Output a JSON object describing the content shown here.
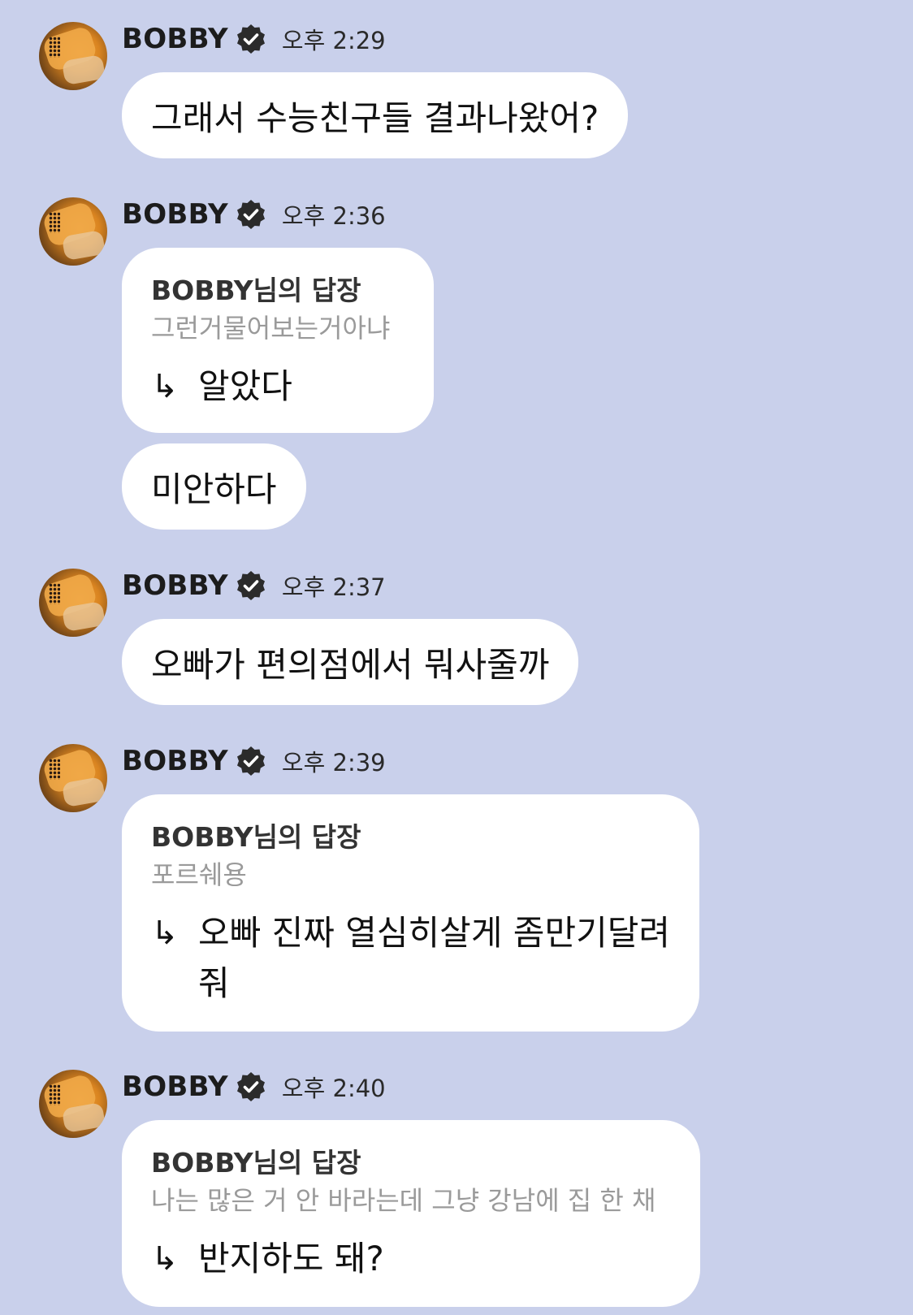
{
  "sender": {
    "name": "BOBBY",
    "avatar": "avatar-photo",
    "verified_icon": "verified-badge-icon"
  },
  "messages": [
    {
      "time": "오후 2:29",
      "bubbles": [
        {
          "type": "text",
          "text": "그래서 수능친구들 결과나왔어?"
        }
      ]
    },
    {
      "time": "오후 2:36",
      "bubbles": [
        {
          "type": "reply",
          "reply_to": "BOBBY님의 답장",
          "quote": "그런거물어보는거아냐",
          "arrow": "↳",
          "text": "알았다"
        },
        {
          "type": "text",
          "text": "미안하다"
        }
      ]
    },
    {
      "time": "오후 2:37",
      "bubbles": [
        {
          "type": "text",
          "text": "오빠가 편의점에서 뭐사줄까"
        }
      ]
    },
    {
      "time": "오후 2:39",
      "bubbles": [
        {
          "type": "reply",
          "reply_to": "BOBBY님의 답장",
          "quote": "포르쉐용",
          "arrow": "↳",
          "text": "오빠 진짜 열심히살게 좀만기달려줘"
        }
      ]
    },
    {
      "time": "오후 2:40",
      "bubbles": [
        {
          "type": "reply",
          "reply_to": "BOBBY님의 답장",
          "quote": "나는 많은 거 안 바라는데 그냥 강남에 집 한 채",
          "arrow": "↳",
          "text": "반지하도 돼?"
        }
      ]
    }
  ],
  "colors": {
    "background": "#c9d0eb",
    "bubble": "#ffffff",
    "quote_text": "#9a9a9a",
    "verified_badge": "#2b2b2b"
  }
}
